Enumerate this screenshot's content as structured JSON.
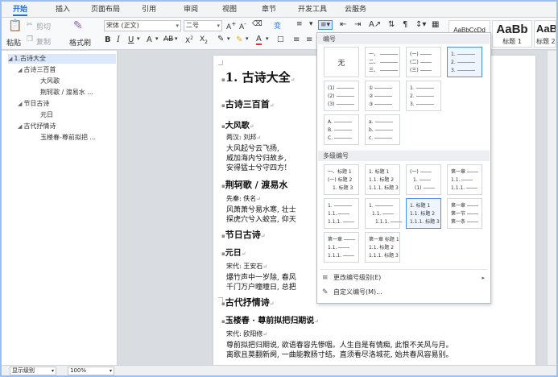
{
  "menu": {
    "tabs": [
      "开始",
      "插入",
      "页面布局",
      "引用",
      "审阅",
      "视图",
      "章节",
      "开发工具",
      "云服务"
    ]
  },
  "ribbon": {
    "paste_label": "粘贴",
    "cut_label": "剪切",
    "copy_label": "复制",
    "format_painter_label": "格式刷",
    "font_name": "宋体 (正文)",
    "font_size": "二号",
    "style_previews": [
      {
        "preview": "AaBbCcDd",
        "label": ""
      },
      {
        "preview": "AaBb",
        "label": "标题 1"
      },
      {
        "preview": "AaBb",
        "label": "标题 2"
      }
    ]
  },
  "nav": {
    "items": [
      {
        "label": "1.古诗大全",
        "level": 0,
        "expanded": true,
        "selected": true
      },
      {
        "label": "古诗三百首",
        "level": 1,
        "expanded": true
      },
      {
        "label": "大风歌",
        "level": 2
      },
      {
        "label": "荆轲歌 / 渡易水 ...",
        "level": 2
      },
      {
        "label": "节日古诗",
        "level": 1,
        "expanded": true
      },
      {
        "label": "元日",
        "level": 2
      },
      {
        "label": "古代抒情诗",
        "level": 1,
        "expanded": true
      },
      {
        "label": "玉楼春-尊前拟把 ...",
        "level": 2
      }
    ]
  },
  "status": {
    "outline_level": "显示级别",
    "zoom": "100%"
  },
  "document": {
    "title": "1. 古诗大全",
    "sec1": "古诗三百首",
    "poem1_title": "大风歌",
    "poem1_author": "两汉: 刘邦",
    "poem1_lines": [
      "大风起兮云飞扬,",
      "威加海内兮归故乡,",
      "安得猛士兮守四方!"
    ],
    "poem2_title": "荆轲歌 / 渡易水",
    "poem2_author": "先秦: 佚名",
    "poem2_lines": [
      "风萧萧兮易水寒, 壮士",
      "探虎穴兮入蛟宫, 仰天"
    ],
    "sec2": "节日古诗",
    "poem3_title": "元日",
    "poem3_author": "宋代: 王安石",
    "poem3_lines": [
      "爆竹声中一岁除, 春风",
      "千门万户曈曈日, 总把"
    ],
    "sec3": "古代抒情诗",
    "poem4_title": "玉楼春 · 尊前拟把归期说",
    "poem4_author": "宋代: 欧阳修",
    "poem4_lines": [
      "尊前拟把归期说, 欲语春容先惨咽。人生自是有情痴, 此恨不关风与月。",
      "离歌且莫翻新阕, 一曲能教肠寸结。直须看尽洛城花, 始共春风容易别。"
    ]
  },
  "dropdown": {
    "numbering_header": "编号",
    "none_label": "无",
    "multilevel_header": "多级编号",
    "change_level": "更改编号级别(E)",
    "custom_numbering": "自定义编号(M)...",
    "cells_single": [
      [
        "一、",
        "二、",
        "三、"
      ],
      [
        "(一)",
        "(二)",
        "(三)"
      ],
      [
        "1.",
        "2.",
        "3."
      ],
      [
        "(1)",
        "(2)",
        "(3)"
      ],
      [
        "①",
        "②",
        "③"
      ],
      [
        "1.",
        "2.",
        "3."
      ],
      [
        "A.",
        "B.",
        "C."
      ],
      [
        "a.",
        "b.",
        "c."
      ]
    ],
    "cells_multi": [
      [
        "一、标题 1",
        "(一) 标题 2",
        "1. 标题 3"
      ],
      [
        "1. 标题 1",
        "1.1. 标题 2",
        "1.1.1. 标题 3"
      ],
      [
        "(一)",
        "1.",
        "(1)"
      ],
      [
        "第一章",
        "1.1.",
        "1.1.1."
      ],
      [
        "1.",
        "1.1.",
        "1.1.1."
      ],
      [
        "1.",
        "1.1.",
        "1.1.1."
      ],
      [
        "1. 标题 1",
        "1.1. 标题 2",
        "1.1.1. 标题 3"
      ],
      [
        "第一章",
        "第一节",
        "第一条"
      ],
      [
        "第一章",
        "1.1.",
        "1.1.1."
      ],
      [
        "第一章 标题 1",
        "1.1. 标题 2",
        "1.1.1. 标题 3"
      ]
    ]
  }
}
